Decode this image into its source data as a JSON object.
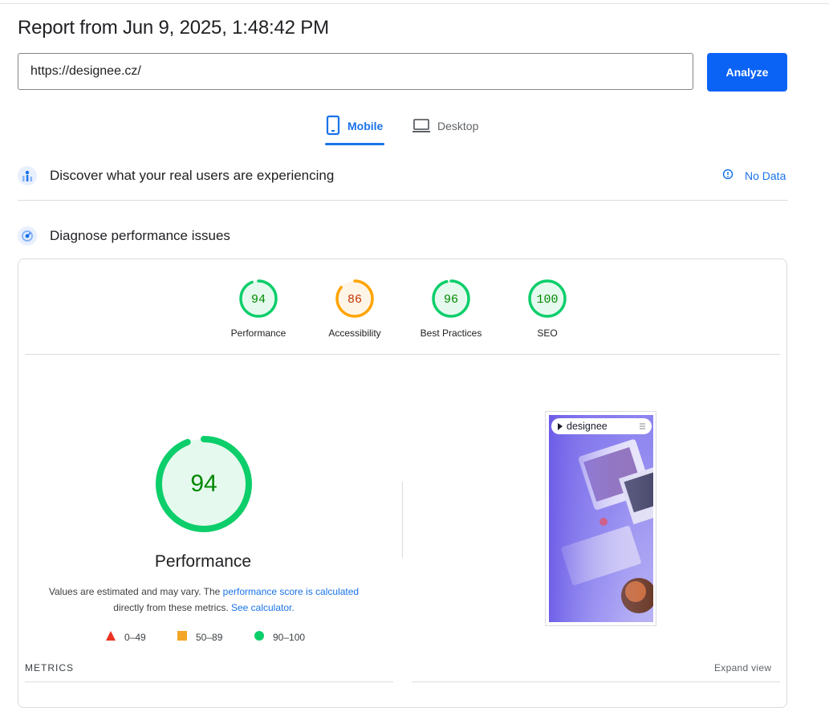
{
  "report": {
    "title": "Report from Jun 9, 2025, 1:48:42 PM"
  },
  "url_bar": {
    "value": "https://designee.cz/"
  },
  "analyze_button": {
    "label": "Analyze"
  },
  "device_tabs": [
    {
      "label": "Mobile",
      "selected": true
    },
    {
      "label": "Desktop",
      "selected": false
    }
  ],
  "field_data": {
    "title": "Discover what your real users are experiencing",
    "status": "No Data"
  },
  "lab_data": {
    "title": "Diagnose performance issues"
  },
  "categories": [
    {
      "label": "Performance",
      "score": 94,
      "status": "pass"
    },
    {
      "label": "Accessibility",
      "score": 86,
      "status": "average"
    },
    {
      "label": "Best Practices",
      "score": 96,
      "status": "pass"
    },
    {
      "label": "SEO",
      "score": 100,
      "status": "pass"
    }
  ],
  "performance": {
    "score": 94,
    "label": "Performance",
    "desc_prefix": "Values are estimated and may vary. The ",
    "desc_link1": "performance score is calculated",
    "desc_middle": "directly from these metrics. ",
    "desc_link2": "See calculator."
  },
  "legend": [
    {
      "range": "0–49",
      "color": "#eb3223"
    },
    {
      "range": "50–89",
      "color": "#f4a628"
    },
    {
      "range": "90–100",
      "color": "#0cce6b"
    }
  ],
  "screenshot": {
    "brand": "designee"
  },
  "metrics_section": {
    "title": "METRICS",
    "expand_label": "Expand view"
  },
  "colors": {
    "pass": "#0cce6b",
    "pass_text": "#008800",
    "pass_bg": "#e6f9ee",
    "average": "#ffa400",
    "average_text": "#c33300",
    "average_bg": "#fff5e6",
    "accent": "#1a73e8",
    "button": "#0b63f6"
  }
}
